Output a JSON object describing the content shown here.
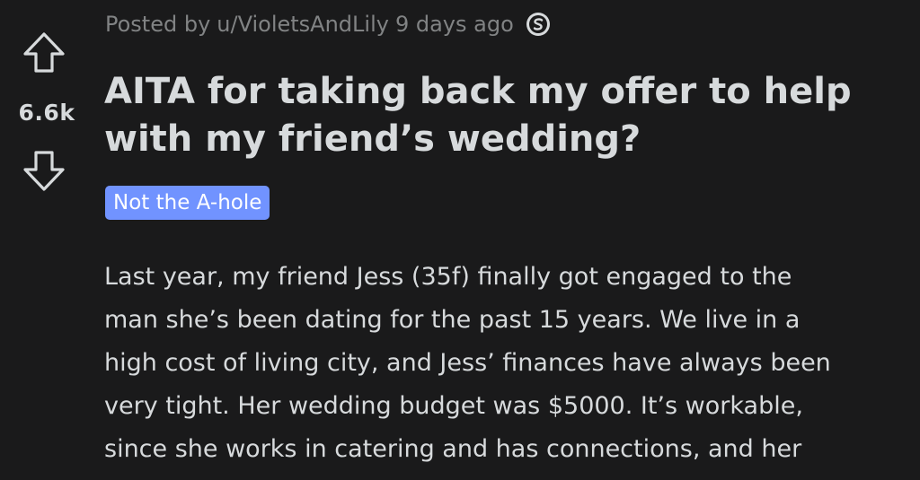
{
  "post": {
    "score": "6.6k",
    "posted_by_prefix": "Posted by",
    "author": "u/VioletsAndLily",
    "time_ago": "9 days ago",
    "award_icon": "silver-award-icon",
    "title": "AITA for taking back my offer to help with my friend’s wedding?",
    "flair": "Not the A-hole",
    "body_lines": [
      "Last year, my friend Jess (35f) finally got engaged to the",
      "man she’s been dating for the past 15 years. We live in a",
      "high cost of living city, and Jess’ finances have always been",
      "very tight. Her wedding budget was $5000. It’s workable,",
      "since she works in catering and has connections, and her"
    ]
  },
  "colors": {
    "background": "#1a1a1b",
    "text": "#d7dadc",
    "meta_text": "#818384",
    "flair_background": "#7193ff"
  }
}
